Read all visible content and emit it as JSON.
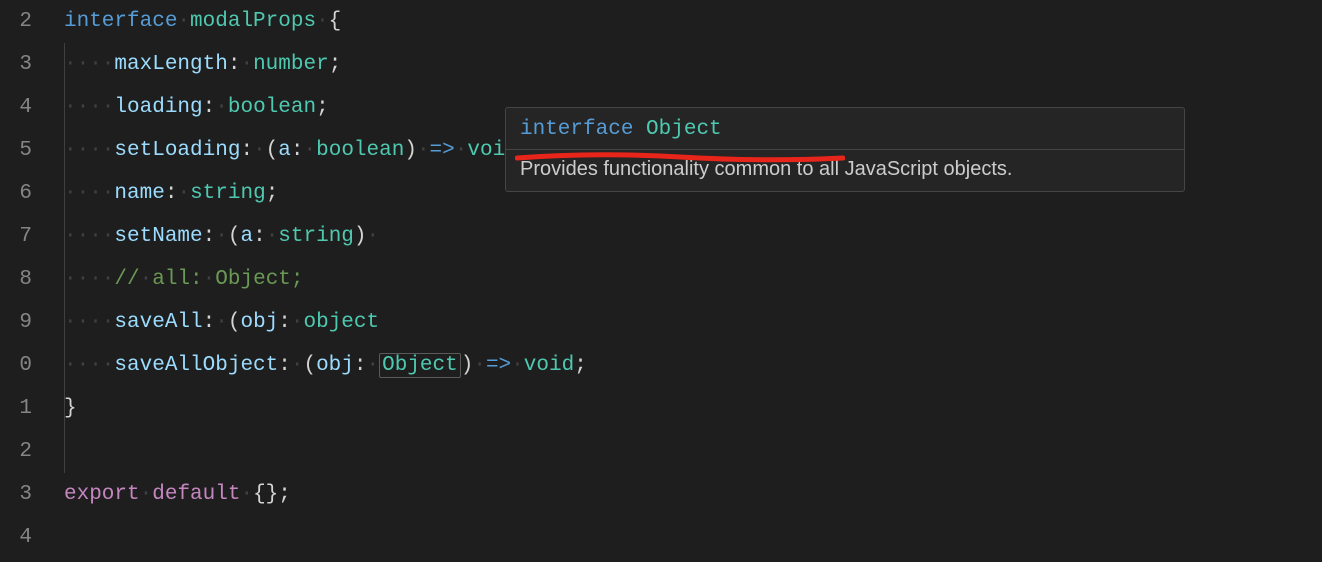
{
  "gutter": [
    "2",
    "3",
    "4",
    "5",
    "6",
    "7",
    "8",
    "9",
    "0",
    "1",
    "2",
    "3",
    "4"
  ],
  "code": {
    "line2": {
      "kw": "interface",
      "name": "modalProps",
      "brace": " {"
    },
    "line3": {
      "prop": "maxLength",
      "type": "number"
    },
    "line4": {
      "prop": "loading",
      "type": "boolean"
    },
    "line5": {
      "prop": "setLoading",
      "param": "a",
      "ptype": "boolean",
      "ret": "void"
    },
    "line6": {
      "prop": "name",
      "type": "string"
    },
    "line7": {
      "prop": "setName",
      "param": "a",
      "ptype": "string"
    },
    "line8": {
      "comment": "// all: Object;"
    },
    "line9": {
      "prop": "saveAll",
      "param": "obj",
      "ptype": "object"
    },
    "line10": {
      "prop": "saveAllObject",
      "param": "obj",
      "ptype": "Object",
      "ret": "void"
    },
    "line11": {
      "brace": "}"
    },
    "line13": {
      "kw1": "export",
      "kw2": "default",
      "rest": " {};"
    }
  },
  "hover": {
    "kw": "interface",
    "name": "Object",
    "desc": "Provides functionality common to all JavaScript objects."
  },
  "dots4": "····",
  "arrow": "=>",
  "colon_sp": ": ",
  "semi": ";",
  "lparen": "(",
  "rparen": ")",
  "space": " "
}
